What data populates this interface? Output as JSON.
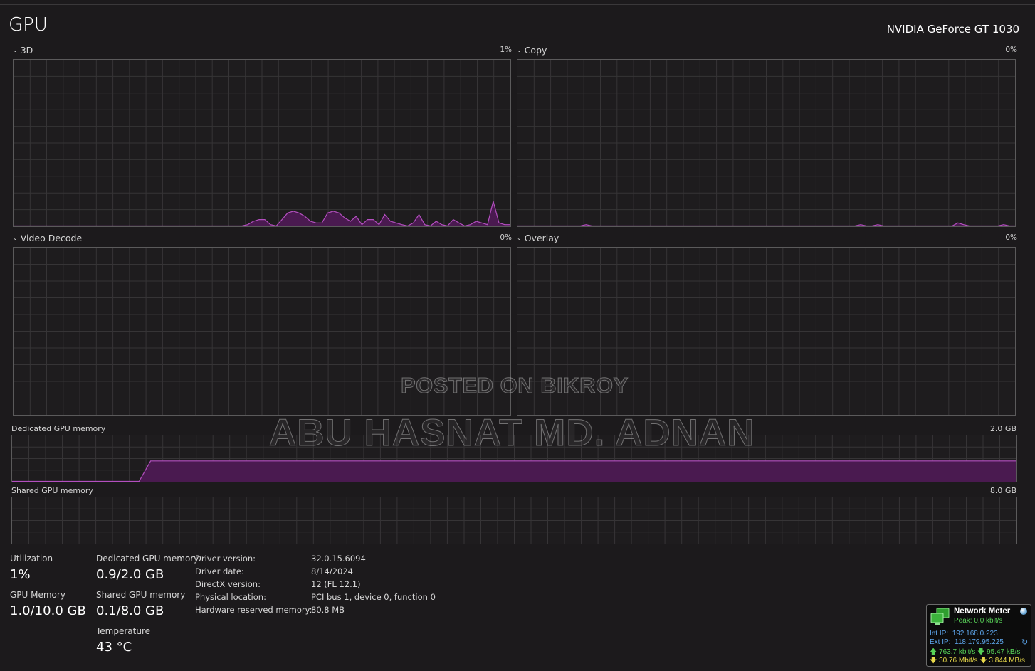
{
  "header": {
    "title": "GPU",
    "gpu_name": "NVIDIA GeForce GT 1030"
  },
  "engines": [
    {
      "label": "3D",
      "percent": "1%"
    },
    {
      "label": "Copy",
      "percent": "0%"
    },
    {
      "label": "Video Decode",
      "percent": "0%"
    },
    {
      "label": "Overlay",
      "percent": "0%"
    }
  ],
  "memory_graphs": {
    "dedicated": {
      "label": "Dedicated GPU memory",
      "max": "2.0 GB"
    },
    "shared": {
      "label": "Shared GPU memory",
      "max": "8.0 GB"
    }
  },
  "stats": {
    "utilization": {
      "label": "Utilization",
      "value": "1%"
    },
    "gpu_memory": {
      "label": "GPU Memory",
      "value": "1.0/10.0 GB"
    },
    "dedicated_memory": {
      "label": "Dedicated GPU memory",
      "value": "0.9/2.0 GB"
    },
    "shared_memory": {
      "label": "Shared GPU memory",
      "value": "0.1/8.0 GB"
    },
    "temperature": {
      "label": "Temperature",
      "value": "43 °C"
    }
  },
  "info": [
    {
      "label": "Driver version:",
      "value": "32.0.15.6094"
    },
    {
      "label": "Driver date:",
      "value": "8/14/2024"
    },
    {
      "label": "DirectX version:",
      "value": "12 (FL 12.1)"
    },
    {
      "label": "Physical location:",
      "value": "PCI bus 1, device 0, function 0"
    },
    {
      "label": "Hardware reserved memory:",
      "value": "80.8 MB"
    }
  ],
  "watermark": {
    "line1": "POSTED ON BIKROY",
    "line2": "ABU HASNAT MD. ADNAN"
  },
  "network_meter": {
    "title": "Network Meter",
    "peak": "Peak: 0.0 kbit/s",
    "int_ip_label": "Int IP:",
    "int_ip": "192.168.0.223",
    "ext_ip_label": "Ext IP:",
    "ext_ip": "118.179.95.225",
    "up_speed_1": "763.7 kbit/s",
    "down_speed_1": "95.47 kB/s",
    "up_speed_2": "30.76 Mbit/s",
    "down_speed_2": "3.844 MB/s"
  },
  "colors": {
    "background": "#1c1a1c",
    "graph_line": "#b34fbf",
    "graph_fill": "#4a1a50",
    "grid": "#363436"
  },
  "chart_data": [
    {
      "type": "area",
      "name": "3D",
      "ylim": [
        0,
        100
      ],
      "values": [
        0,
        0,
        0,
        0,
        0,
        0,
        0,
        0,
        0,
        0,
        0,
        0,
        0,
        0,
        0,
        0,
        0,
        0,
        0,
        0,
        0,
        0,
        0,
        0,
        0,
        0,
        0,
        0,
        0,
        0,
        0,
        0,
        0,
        0,
        0,
        0,
        0,
        0,
        0,
        0,
        0,
        1,
        3,
        4,
        4,
        1,
        0,
        4,
        8,
        9,
        8,
        6,
        3,
        2,
        2,
        8,
        9,
        8,
        5,
        3,
        6,
        1,
        4,
        4,
        1,
        7,
        3,
        2,
        1,
        0,
        2,
        7,
        1,
        0,
        3,
        1,
        0,
        4,
        2,
        0,
        1,
        3,
        2,
        1,
        15,
        2,
        1,
        1
      ]
    },
    {
      "type": "area",
      "name": "Copy",
      "ylim": [
        0,
        100
      ],
      "values": [
        0,
        0,
        0,
        0,
        0,
        0,
        0,
        0,
        0,
        0,
        0,
        0,
        1,
        0,
        0,
        0,
        0,
        0,
        0,
        0,
        0,
        0,
        0,
        0,
        0,
        0,
        0,
        0,
        0,
        0,
        0,
        0,
        0,
        0,
        0,
        0,
        0,
        0,
        0,
        0,
        0,
        0,
        0,
        0,
        0,
        0,
        0,
        0,
        0,
        0,
        0,
        0,
        0,
        0,
        0,
        0,
        0,
        0,
        0,
        0,
        1,
        0,
        0,
        1,
        0,
        0,
        0,
        0,
        0,
        0,
        0,
        0,
        0,
        0,
        0,
        0,
        0,
        2,
        1,
        0,
        0,
        0,
        0,
        0,
        0,
        1,
        0,
        0
      ]
    },
    {
      "type": "area",
      "name": "Video Decode",
      "ylim": [
        0,
        100
      ],
      "values": []
    },
    {
      "type": "area",
      "name": "Overlay",
      "ylim": [
        0,
        100
      ],
      "values": []
    },
    {
      "type": "area",
      "name": "Dedicated GPU memory",
      "ylim": [
        0,
        2.0
      ],
      "values": [
        0,
        0,
        0,
        0,
        0,
        0,
        0,
        0,
        0,
        0,
        0,
        0,
        0.9,
        0.9,
        0.9,
        0.9,
        0.9,
        0.9,
        0.9,
        0.9,
        0.9,
        0.9,
        0.9,
        0.9,
        0.9,
        0.9,
        0.9,
        0.9,
        0.9,
        0.9,
        0.9,
        0.9,
        0.9,
        0.9,
        0.9,
        0.9,
        0.9,
        0.9,
        0.9,
        0.9,
        0.9,
        0.9,
        0.9,
        0.9,
        0.9,
        0.9,
        0.9,
        0.9,
        0.9,
        0.9,
        0.9,
        0.9,
        0.9,
        0.9,
        0.9,
        0.9,
        0.9,
        0.9,
        0.9,
        0.9,
        0.9,
        0.9,
        0.9,
        0.9,
        0.9,
        0.9,
        0.9,
        0.9,
        0.9,
        0.9,
        0.9,
        0.9,
        0.9,
        0.9,
        0.9,
        0.9,
        0.9,
        0.9,
        0.9,
        0.9,
        0.9,
        0.9,
        0.9,
        0.9,
        0.9,
        0.9,
        0.9,
        0.9
      ]
    },
    {
      "type": "area",
      "name": "Shared GPU memory",
      "ylim": [
        0,
        8.0
      ],
      "values": []
    }
  ]
}
